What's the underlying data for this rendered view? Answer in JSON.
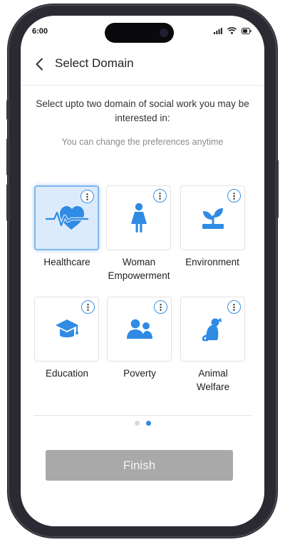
{
  "status_bar": {
    "time": "6:00"
  },
  "header": {
    "title": "Select Domain"
  },
  "prompt": "Select upto two domain of social work you may be interested in:",
  "subtext": "You can change the preferences anytime",
  "domains": [
    {
      "label": "Healthcare",
      "icon": "heartbeat-icon",
      "selected": true
    },
    {
      "label": "Woman Empowerment",
      "icon": "woman-icon",
      "selected": false
    },
    {
      "label": "Environment",
      "icon": "sprout-icon",
      "selected": false
    },
    {
      "label": "Education",
      "icon": "graduation-cap-icon",
      "selected": false
    },
    {
      "label": "Poverty",
      "icon": "people-icon",
      "selected": false
    },
    {
      "label": "Animal Welfare",
      "icon": "dog-icon",
      "selected": false
    }
  ],
  "pager": {
    "page_count": 2,
    "current_page": 2
  },
  "finish_label": "Finish",
  "colors": {
    "accent": "#2F8BE4",
    "selected_bg": "#DCEBFB",
    "button_disabled": "#A9A9A9"
  }
}
